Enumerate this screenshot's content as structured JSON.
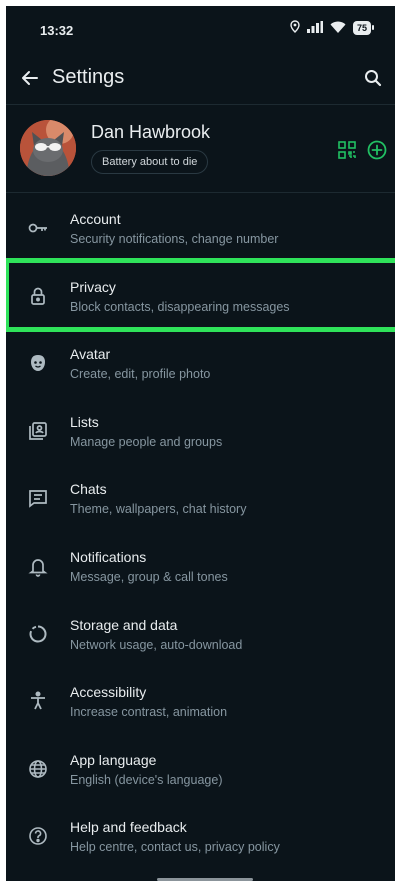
{
  "status_bar": {
    "time": "13:32",
    "battery": "75"
  },
  "header": {
    "title": "Settings"
  },
  "profile": {
    "name": "Dan Hawbrook",
    "status": "Battery about to die"
  },
  "colors": {
    "accent": "#21c063",
    "background": "#0b141a",
    "secondary_text": "#8696a0",
    "highlight": "#2fe35a"
  },
  "menu": [
    {
      "icon": "key-icon",
      "title": "Account",
      "subtitle": "Security notifications, change number"
    },
    {
      "icon": "lock-icon",
      "title": "Privacy",
      "subtitle": "Block contacts, disappearing messages"
    },
    {
      "icon": "avatar-face-icon",
      "title": "Avatar",
      "subtitle": "Create, edit, profile photo"
    },
    {
      "icon": "lists-icon",
      "title": "Lists",
      "subtitle": "Manage people and groups"
    },
    {
      "icon": "chat-icon",
      "title": "Chats",
      "subtitle": "Theme, wallpapers, chat history"
    },
    {
      "icon": "bell-icon",
      "title": "Notifications",
      "subtitle": "Message, group & call tones"
    },
    {
      "icon": "storage-circle-icon",
      "title": "Storage and data",
      "subtitle": "Network usage, auto-download"
    },
    {
      "icon": "accessibility-icon",
      "title": "Accessibility",
      "subtitle": "Increase contrast, animation"
    },
    {
      "icon": "globe-icon",
      "title": "App language",
      "subtitle": "English (device's language)"
    },
    {
      "icon": "help-icon",
      "title": "Help and feedback",
      "subtitle": "Help centre, contact us, privacy policy"
    }
  ]
}
